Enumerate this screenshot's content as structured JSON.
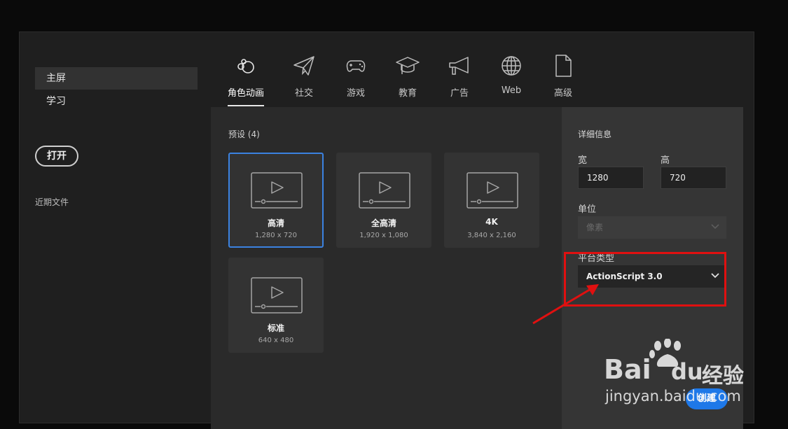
{
  "sidebar": {
    "items": [
      {
        "label": "主屏",
        "active": true
      },
      {
        "label": "学习",
        "active": false
      }
    ],
    "open_button": "打开",
    "recent_label": "近期文件"
  },
  "categories": [
    {
      "label": "角色动画",
      "icon": "character-animation-icon",
      "active": true
    },
    {
      "label": "社交",
      "icon": "paper-plane-icon",
      "active": false
    },
    {
      "label": "游戏",
      "icon": "gamepad-icon",
      "active": false
    },
    {
      "label": "教育",
      "icon": "graduation-cap-icon",
      "active": false
    },
    {
      "label": "广告",
      "icon": "megaphone-icon",
      "active": false
    },
    {
      "label": "Web",
      "icon": "globe-icon",
      "active": false
    },
    {
      "label": "高级",
      "icon": "document-icon",
      "active": false
    }
  ],
  "presets": {
    "title": "预设 (4)",
    "items": [
      {
        "name": "高清",
        "dim": "1,280 x 720",
        "selected": true
      },
      {
        "name": "全高清",
        "dim": "1,920 x 1,080",
        "selected": false
      },
      {
        "name": "4K",
        "dim": "3,840 x 2,160",
        "selected": false
      },
      {
        "name": "标准",
        "dim": "640 x 480",
        "selected": false
      }
    ]
  },
  "details": {
    "title": "详细信息",
    "width_label": "宽",
    "width_value": "1280",
    "height_label": "高",
    "height_value": "720",
    "unit_label": "单位",
    "unit_value": "像素",
    "platform_label": "平台类型",
    "platform_value": "ActionScript 3.0",
    "create_label": "创建"
  },
  "watermark": {
    "brand": "Bai",
    "brand2": "du",
    "brand_cn": "经验",
    "url": "jingyan.baidu.com"
  },
  "colors": {
    "accent": "#3b82e0",
    "create_button": "#1e78e8",
    "annotation": "#e01010"
  }
}
